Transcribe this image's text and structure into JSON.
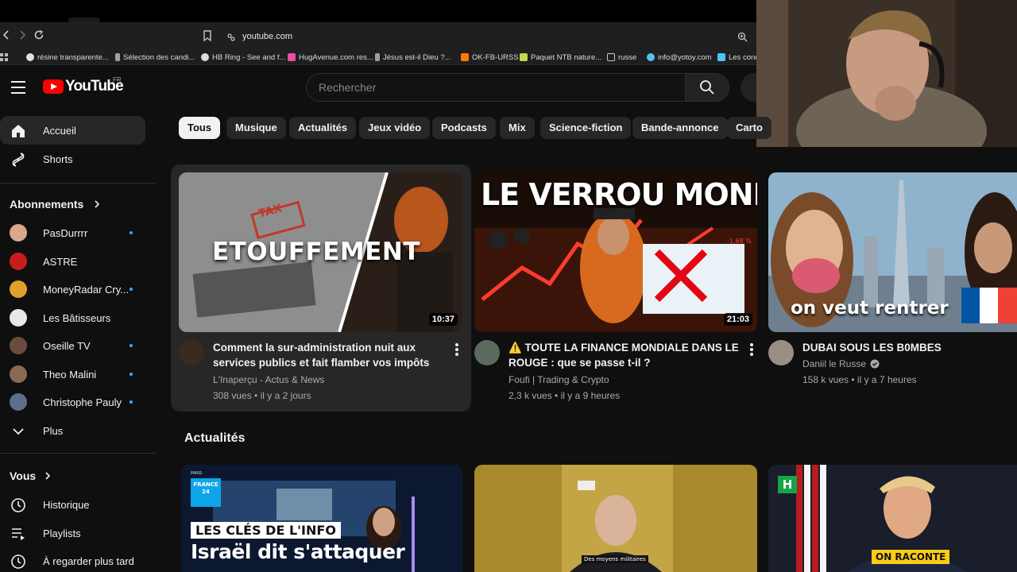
{
  "browser": {
    "url": "youtube.com",
    "bookmarks": [
      {
        "label": "résine transparente...",
        "color": "#e0e0e0"
      },
      {
        "label": "Sélection des candi...",
        "color": "#9aa0a6"
      },
      {
        "label": "HB Ring - See and f...",
        "color": "#dddddd"
      },
      {
        "label": "HugAvenue.com res...",
        "color": "#e94ea0"
      },
      {
        "label": "Jésus est-il Dieu ?...",
        "color": "#9aa0a6"
      },
      {
        "label": "OK-FB-URSS",
        "color": "#ff7a00"
      },
      {
        "label": "Paquet NTB nature...",
        "color": "#c8d64a"
      },
      {
        "label": "russe",
        "color": "#9aa0a6"
      },
      {
        "label": "info@yotoy.com",
        "color": "#4fc3f7"
      },
      {
        "label": "Les conc",
        "color": "#4fc3f7"
      }
    ]
  },
  "header": {
    "logo_text": "YouTube",
    "country_code": "FR",
    "search_placeholder": "Rechercher"
  },
  "sidebar": {
    "home": "Accueil",
    "shorts": "Shorts",
    "subscriptions_title": "Abonnements",
    "subscriptions": [
      {
        "label": "PasDurrrr",
        "new": true,
        "color": "#d9a78a"
      },
      {
        "label": "ASTRE",
        "new": false,
        "color": "#c91d1d"
      },
      {
        "label": "MoneyRadar Cry...",
        "new": true,
        "color": "#e0a12b"
      },
      {
        "label": "Les Bâtisseurs",
        "new": false,
        "color": "#e8e8e8"
      },
      {
        "label": "Oseille TV",
        "new": true,
        "color": "#6b4b3e"
      },
      {
        "label": "Theo Malini",
        "new": true,
        "color": "#8a6a55"
      },
      {
        "label": "Christophe Pauly",
        "new": true,
        "color": "#5b6e8a"
      }
    ],
    "more": "Plus",
    "you_title": "Vous",
    "you_items": [
      "Historique",
      "Playlists",
      "À regarder plus tard"
    ]
  },
  "chips": [
    "Tous",
    "Musique",
    "Actualités",
    "Jeux vidéo",
    "Podcasts",
    "Mix",
    "Science-fiction",
    "Bande-annonce",
    "Carto"
  ],
  "videos": [
    {
      "title": "Comment la sur-administration nuit aux services publics et fait flamber vos impôts",
      "channel": "L'Inaperçu - Actus & News",
      "views": "308 vues",
      "age": "il y a 2 jours",
      "duration": "10:37",
      "thumb_text": "ETOUFFEMENT",
      "thumb_sub": "TAX"
    },
    {
      "title": "⚠️ TOUTE LA FINANCE MONDIALE DANS LE ROUGE : que se passe t-il ?",
      "channel": "Foufi | Trading & Crypto",
      "views": "2,3 k vues",
      "age": "il y a 9 heures",
      "duration": "21:03",
      "thumb_text": "LE VERROU MONDIAL",
      "thumb_sub": "-1,68 %"
    },
    {
      "title": "DUBAI SOUS LES B0MBES",
      "channel": "Daniil le Russe",
      "views": "158 k vues",
      "age": "il y a 7 heures",
      "duration": "",
      "thumb_text": "on veut rentrer"
    }
  ],
  "news_section": {
    "title": "Actualités",
    "cards": [
      {
        "badge": "FRANCE 24",
        "tag": "PARIS",
        "kicker": "LES CLÉS DE L'INFO",
        "headline": "Israël dit s'attaquer"
      },
      {
        "caption": "Des moyens militaires"
      },
      {
        "badge": "H",
        "caption": "ON RACONTE"
      }
    ]
  },
  "colors": {
    "background": "#0f0f0f",
    "accent": "#ff0000",
    "chip": "#272727",
    "chip_active": "#f1f1f1",
    "secondary_text": "#aaaaaa"
  }
}
